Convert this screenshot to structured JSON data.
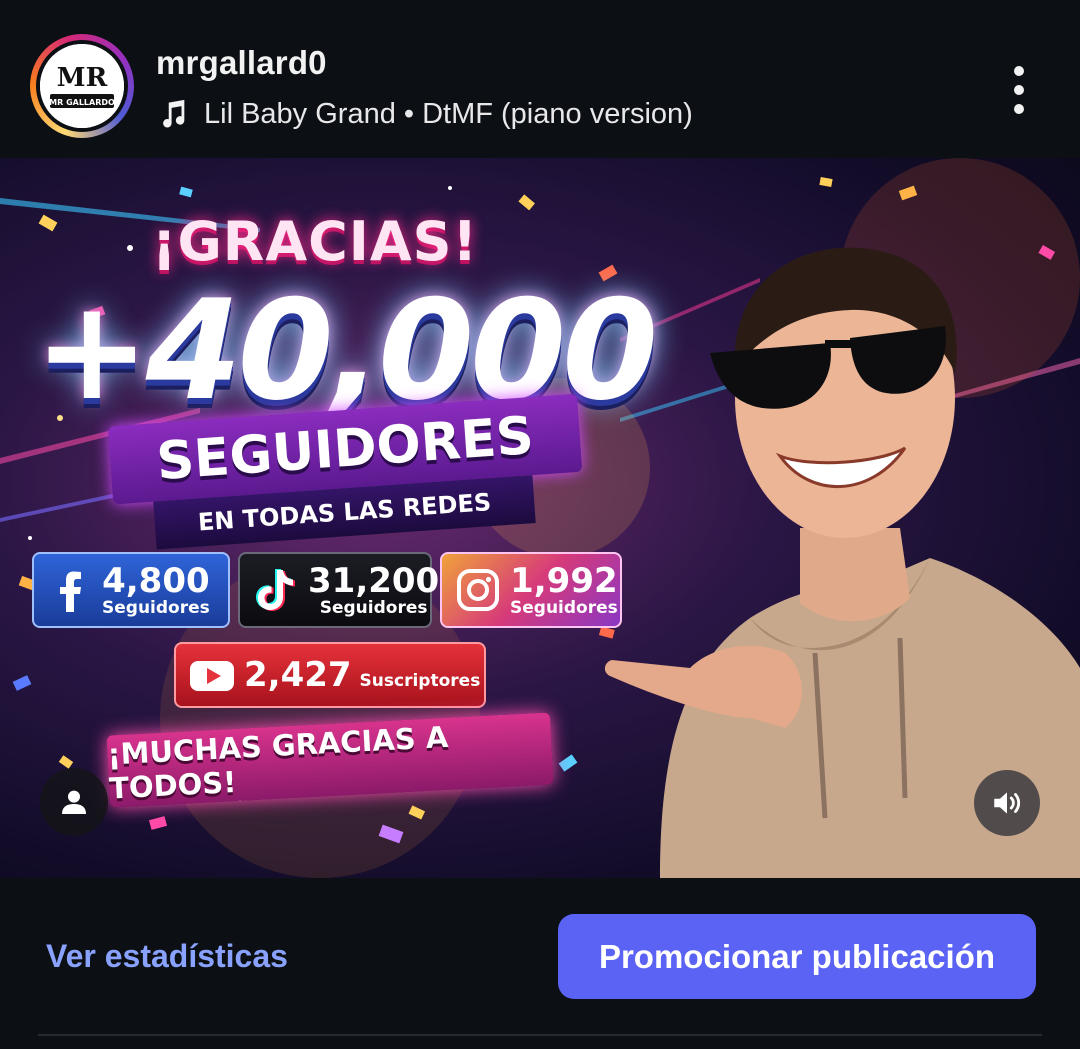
{
  "post_header": {
    "username": "mrgallard0",
    "avatar_text_top": "MR",
    "avatar_text_bottom": "MR GALLARDO",
    "music": {
      "icon": "music-note-icon",
      "text": "Lil Baby Grand • DtMF (piano version)"
    },
    "more_icon": "more-vertical-icon"
  },
  "media": {
    "headline": "¡GRACIAS!",
    "big_number": "+40,000",
    "banner_main": "SEGUIDORES",
    "banner_sub": "EN TODAS LAS REDES",
    "stats": [
      {
        "platform": "facebook",
        "icon": "facebook-icon",
        "value": "4,800",
        "label": "Seguidores",
        "color": "#2f64d8"
      },
      {
        "platform": "tiktok",
        "icon": "tiktok-icon",
        "value": "31,200",
        "label": "Seguidores",
        "color": "#111118"
      },
      {
        "platform": "instagram",
        "icon": "instagram-icon",
        "value": "1,992",
        "label": "Seguidores",
        "color": "#d63a7a"
      }
    ],
    "youtube": {
      "icon": "youtube-icon",
      "value": "2,427",
      "label": "Suscriptores",
      "color": "#e5323b"
    },
    "thanks_banner": "¡MUCHAS GRACIAS A TODOS!",
    "tag_icon": "user-tag-icon",
    "sound_icon": "volume-icon"
  },
  "footer": {
    "stats_link": "Ver estadísticas",
    "promote_button": "Promocionar publicación"
  },
  "colors": {
    "background": "#0c0f14",
    "accent_button": "#5b63f5",
    "link": "#8aa2ff"
  }
}
